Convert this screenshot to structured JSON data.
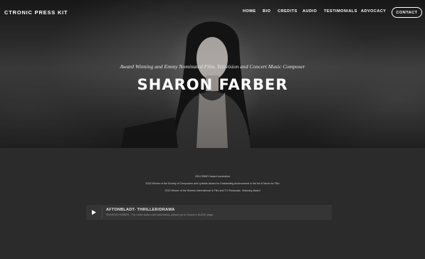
{
  "header": {
    "brand": "CTRONIC PRESS KIT",
    "nav": [
      "HOME",
      "BIO",
      "CREDITS",
      "AUDIO",
      "TESTIMONIALS",
      "ADVOCACY"
    ],
    "contact_label": "CONTACT"
  },
  "hero": {
    "tagline": "Award Winning and Emmy Nominated Film, Television and Concert Music Composer",
    "title": "SHARON FARBER"
  },
  "awards": [
    "2014 EMMY Award nomination",
    "2015 Winner of the Society of Composers and Lyricists Award for Outstanding Achievement in the Art of Music for Film",
    "2012 Winner of the Women International in Film and TV Showcase- Visionary Award"
  ],
  "player": {
    "title": "AFTONBLADT- THRILLER/DRAMA",
    "subtitle": "SHARON FARBER - For more audio cues and tracks, please go to Sharon's AUDIO page.",
    "icon": "play-icon"
  },
  "colors": {
    "background": "#2b2b2b",
    "player_bg": "#353535",
    "text": "#ffffff"
  }
}
